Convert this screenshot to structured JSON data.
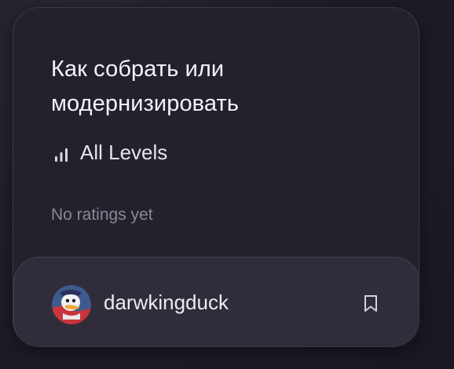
{
  "card": {
    "title": "Как собрать или модернизировать",
    "level_icon": "signal-bars-icon",
    "level": "All Levels",
    "ratings": "No ratings yet"
  },
  "author": {
    "username": "darwkingduck",
    "avatar_icon": "duck-avatar",
    "bookmark_icon": "bookmark-icon"
  }
}
